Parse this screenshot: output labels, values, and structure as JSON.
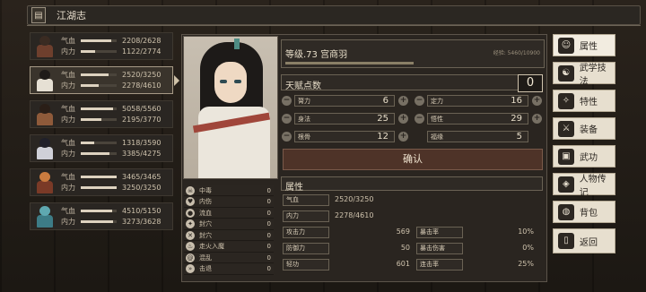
{
  "topbar": {
    "title": "江湖志",
    "icon": "book-icon"
  },
  "roster": [
    {
      "hp_label": "气血",
      "hp": "2208/2628",
      "hp_frac": 0.84,
      "mp_label": "内力",
      "mp": "1122/2774",
      "mp_frac": 0.4,
      "colors": [
        "#3a2b22",
        "#6e3f2d"
      ]
    },
    {
      "hp_label": "气血",
      "hp": "2520/3250",
      "hp_frac": 0.78,
      "mp_label": "内力",
      "mp": "2278/4610",
      "mp_frac": 0.49,
      "colors": [
        "#1f1b19",
        "#e6e0d4"
      ],
      "selected": true
    },
    {
      "hp_label": "气血",
      "hp": "5058/5560",
      "hp_frac": 0.91,
      "mp_label": "内力",
      "mp": "2195/3770",
      "mp_frac": 0.58,
      "colors": [
        "#2a1e17",
        "#8e5a3a"
      ]
    },
    {
      "hp_label": "气血",
      "hp": "1318/3590",
      "hp_frac": 0.37,
      "mp_label": "内力",
      "mp": "3385/4275",
      "mp_frac": 0.79,
      "colors": [
        "#20202a",
        "#cfd0d8"
      ]
    },
    {
      "hp_label": "气血",
      "hp": "3465/3465",
      "hp_frac": 1.0,
      "mp_label": "内力",
      "mp": "3250/3250",
      "mp_frac": 1.0,
      "colors": [
        "#c97b3f",
        "#7a3a27"
      ]
    },
    {
      "hp_label": "气血",
      "hp": "4510/5150",
      "hp_frac": 0.88,
      "mp_label": "内力",
      "mp": "3273/3628",
      "mp_frac": 0.9,
      "colors": [
        "#5fa8b0",
        "#3d7c86"
      ]
    }
  ],
  "character": {
    "level_name": "等级.73  宫商羽",
    "exp": "经验: 5460/10900",
    "exp_frac": 0.5,
    "talent_label": "天赋点数",
    "talent_points": "0"
  },
  "attributes": [
    {
      "label": "膂力",
      "value": "6"
    },
    {
      "label": "定力",
      "value": "16"
    },
    {
      "label": "身法",
      "value": "25"
    },
    {
      "label": "悟性",
      "value": "29"
    },
    {
      "label": "根骨",
      "value": "12"
    },
    {
      "label": "福缘",
      "value": "5"
    }
  ],
  "confirm_label": "确认",
  "status_effects": [
    {
      "label": "中毒",
      "value": "0",
      "icon": "skull-icon"
    },
    {
      "label": "内伤",
      "value": "0",
      "icon": "heart-icon"
    },
    {
      "label": "流血",
      "value": "0",
      "icon": "blood-icon"
    },
    {
      "label": "封穴",
      "value": "0",
      "icon": "needle-icon"
    },
    {
      "label": "封穴",
      "value": "0",
      "icon": "lock-icon"
    },
    {
      "label": "走火入魔",
      "value": "0",
      "icon": "fire-icon"
    },
    {
      "label": "混乱",
      "value": "0",
      "icon": "swirl-icon"
    },
    {
      "label": "击退",
      "value": "0",
      "icon": "push-icon"
    }
  ],
  "section_attr_label": "属性",
  "vitals": [
    {
      "label": "气血",
      "value": "2520/3250"
    },
    {
      "label": "内力",
      "value": "2278/4610"
    }
  ],
  "combat_left": [
    {
      "label": "攻击力",
      "value": "569"
    },
    {
      "label": "防御力",
      "value": "50"
    },
    {
      "label": "轻功",
      "value": "601"
    }
  ],
  "combat_right": [
    {
      "label": "暴击率",
      "value": "10%"
    },
    {
      "label": "暴击伤害",
      "value": "0%"
    },
    {
      "label": "连击率",
      "value": "25%"
    }
  ],
  "menu": [
    {
      "label": "属性",
      "icon": "person-icon",
      "active": true
    },
    {
      "label": "武学技法",
      "icon": "martial-arts-icon"
    },
    {
      "label": "特性",
      "icon": "trait-icon"
    },
    {
      "label": "装备",
      "icon": "sword-icon"
    },
    {
      "label": "武功",
      "icon": "scroll-icon"
    },
    {
      "label": "人物传记",
      "icon": "biography-icon"
    },
    {
      "label": "背包",
      "icon": "bag-icon"
    },
    {
      "label": "返回",
      "icon": "door-icon"
    }
  ]
}
